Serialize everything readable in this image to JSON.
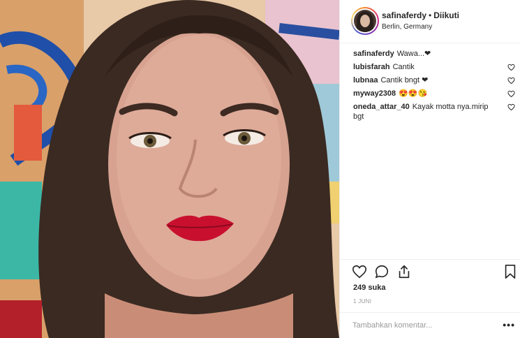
{
  "post": {
    "username": "safinaferdy",
    "separator": "•",
    "follow_status": "Diikuti",
    "location": "Berlin, Germany"
  },
  "comments": [
    {
      "user": "safinaferdy",
      "text": "Wawa...❤",
      "has_like": false
    },
    {
      "user": "lubisfarah",
      "text": "Cantik",
      "has_like": true
    },
    {
      "user": "lubnaa",
      "text": "Cantik bngt ❤",
      "has_like": true
    },
    {
      "user": "myway2308",
      "text": "😍😍😘",
      "has_like": true
    },
    {
      "user": "oneda_attar_40",
      "text": "Kayak motta nya.mirip bgt",
      "has_like": true
    }
  ],
  "actions": {
    "like_icon": "heart-icon",
    "comment_icon": "comment-bubble-icon",
    "share_icon": "share-icon",
    "save_icon": "bookmark-icon"
  },
  "likes": "249 suka",
  "date": "1 JUNI",
  "add_comment": {
    "placeholder": "Tambahkan komentar...",
    "more_label": "•••"
  },
  "colors": {
    "text": "#262626",
    "muted": "#999999",
    "border": "#efefef",
    "lipstick": "#c8102e"
  }
}
